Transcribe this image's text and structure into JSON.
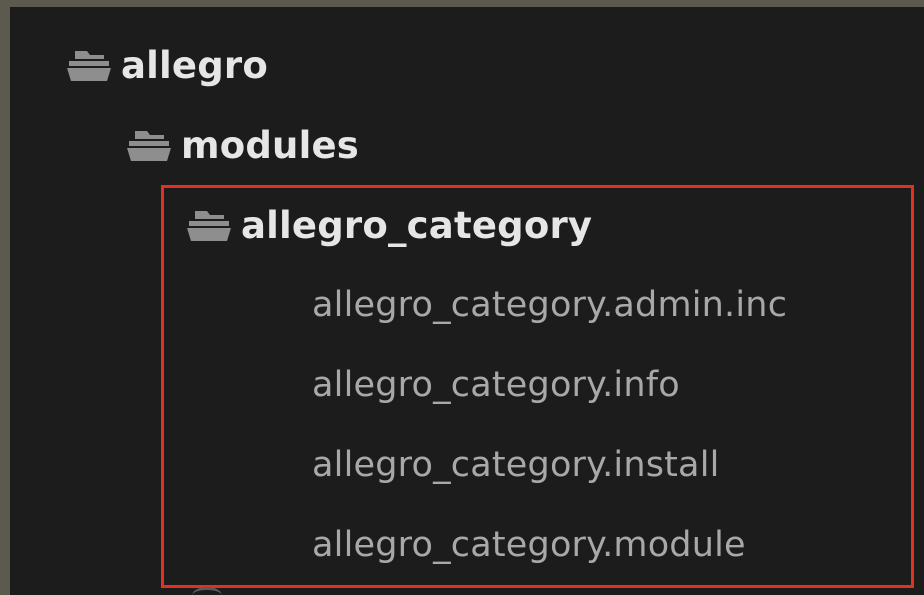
{
  "tree": {
    "items": [
      {
        "label": "allegro",
        "kind": "folder",
        "icon": "folder-open-icon"
      },
      {
        "label": "modules",
        "kind": "folder",
        "icon": "folder-open-icon"
      },
      {
        "label": "allegro_category",
        "kind": "folder",
        "icon": "folder-open-icon"
      },
      {
        "label": "allegro_category.admin.inc",
        "kind": "file"
      },
      {
        "label": "allegro_category.info",
        "kind": "file"
      },
      {
        "label": "allegro_category.install",
        "kind": "file"
      },
      {
        "label": "allegro_category.module",
        "kind": "file"
      }
    ]
  },
  "colors": {
    "background": "#1c1c1c",
    "frame": "#5c5a4f",
    "folder_text": "#e6e6e6",
    "file_text": "#a8a8a8",
    "highlight": "#e3311f"
  }
}
